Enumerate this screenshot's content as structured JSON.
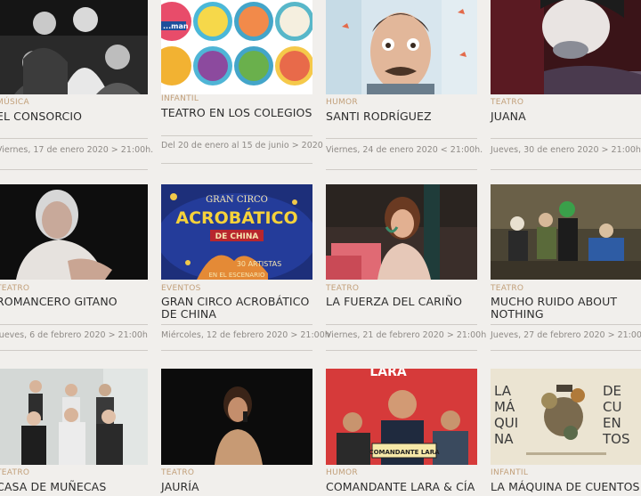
{
  "cards": [
    {
      "category": "MÚSICA",
      "title": "EL CONSORCIO",
      "date": "Viernes, 17 de enero 2020 > 21:00h."
    },
    {
      "category": "INFANTIL",
      "title": "TEATRO EN LOS COLEGIOS",
      "date": "Del 20 de enero al 15 de junio > 2020",
      "thumb_text": "...man"
    },
    {
      "category": "HUMOR",
      "title": "SANTI RODRÍGUEZ",
      "date": "Viernes, 24 de enero 2020 < 21:00h."
    },
    {
      "category": "TEATRO",
      "title": "JUANA",
      "date": "Jueves, 30 de enero 2020 > 21:00h"
    },
    {
      "category": "TEATRO",
      "title": "ROMANCERO GITANO",
      "date": "Jueves, 6 de febrero 2020 > 21:00h"
    },
    {
      "category": "EVENTOS",
      "title": "GRAN CIRCO ACROBÁTICO DE CHINA",
      "date": "Miércoles, 12 de febrero 2020 > 21:00h",
      "poster": {
        "line1": "GRAN CIRCO",
        "line2": "ACROBÁTICO",
        "line3": "DE CHINA",
        "line4": "30 ARTISTAS",
        "line5": "EN EL ESCENARIO"
      }
    },
    {
      "category": "TEATRO",
      "title": "LA FUERZA DEL CARIÑO",
      "date": "Viernes, 21 de febrero 2020 > 21:00h"
    },
    {
      "category": "TEATRO",
      "title": "MUCHO RUIDO ABOUT NOTHING",
      "date": "Jueves, 27 de febrero 2020 > 21:00h"
    },
    {
      "category": "TEATRO",
      "title": "CASA DE MUÑECAS",
      "date": ""
    },
    {
      "category": "TEATRO",
      "title": "JAURÍA",
      "date": ""
    },
    {
      "category": "HUMOR",
      "title": "COMANDANTE LARA & CÍA",
      "date": "",
      "poster": {
        "top": "LARA",
        "badge": "COMANDANTE LARA"
      }
    },
    {
      "category": "INFANTIL",
      "title": "LA MÁQUINA DE CUENTOS",
      "date": "",
      "poster": {
        "left": [
          "LA",
          "MÁ",
          "QUI",
          "NA"
        ],
        "right": [
          "DE",
          "CU",
          "EN",
          "TOS"
        ]
      }
    }
  ]
}
